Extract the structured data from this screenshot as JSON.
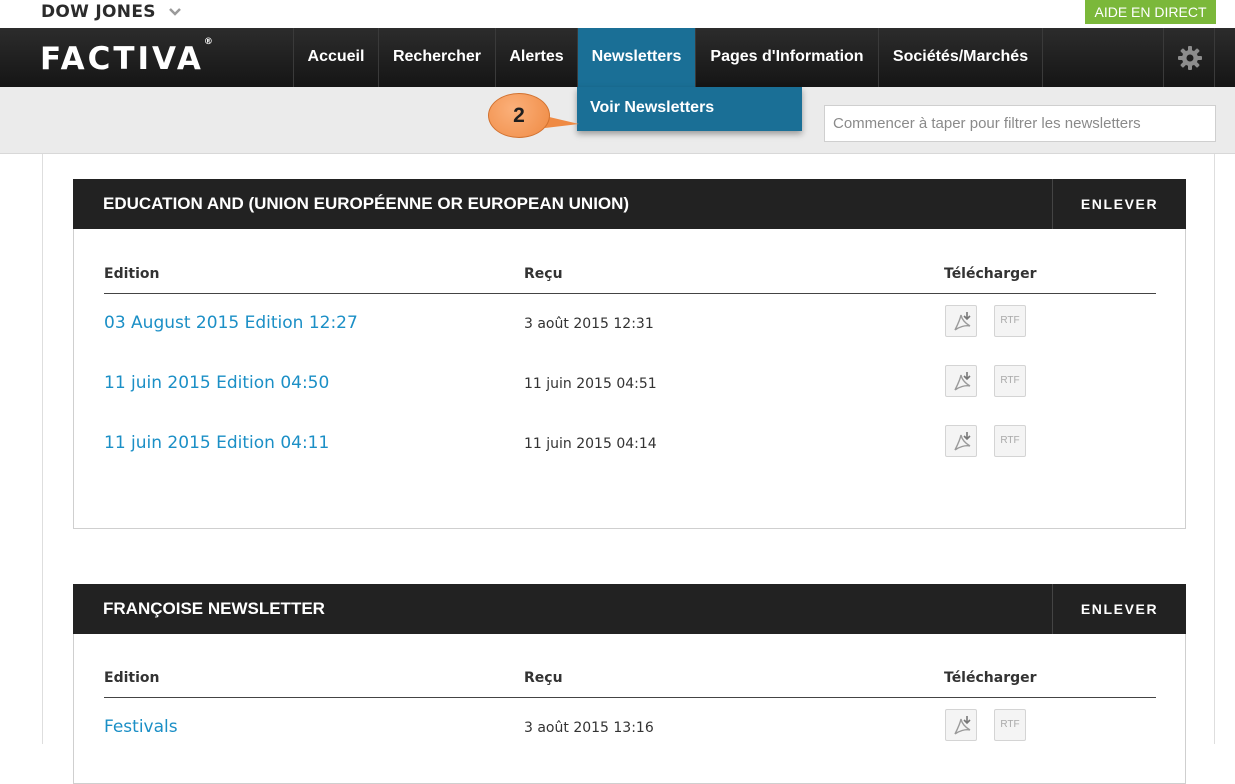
{
  "brand": {
    "dow_jones": "DOW JONES",
    "logo": "FACTIVA",
    "logo_mark": "®"
  },
  "help_button": "AIDE EN DIRECT",
  "nav": {
    "items": [
      {
        "label": "Accueil"
      },
      {
        "label": "Rechercher"
      },
      {
        "label": "Alertes"
      },
      {
        "label": "Newsletters",
        "active": true
      },
      {
        "label": "Pages d'Information"
      },
      {
        "label": "Sociétés/Marchés"
      }
    ],
    "settings_icon": "gear-icon"
  },
  "dropdown": {
    "item": "Voir Newsletters"
  },
  "callout": {
    "number": "2"
  },
  "filter": {
    "placeholder": "Commencer à taper pour filtrer les newsletters",
    "value": ""
  },
  "columns": {
    "edition": "Edition",
    "received": "Reçu",
    "download": "Télécharger"
  },
  "download_icons": {
    "pdf": "pdf-download-icon",
    "rtf": "RTF"
  },
  "newsletters": [
    {
      "title": "EDUCATION AND (UNION EUROPÉENNE OR EUROPEAN UNION)",
      "remove_label": "ENLEVER",
      "editions": [
        {
          "name": "03 August 2015 Edition 12:27",
          "received": "3 août 2015 12:31"
        },
        {
          "name": "11 juin 2015 Edition 04:50",
          "received": "11 juin 2015 04:51"
        },
        {
          "name": "11 juin 2015 Edition 04:11",
          "received": "11 juin 2015 04:14"
        }
      ]
    },
    {
      "title": "FRANÇOISE NEWSLETTER",
      "remove_label": "ENLEVER",
      "editions": [
        {
          "name": "Festivals",
          "received": "3 août 2015 13:16"
        }
      ]
    }
  ],
  "colors": {
    "accent": "#1a6f96",
    "link": "#1b8fc6",
    "help_green": "#7bb83a",
    "callout": "#ef8a43"
  }
}
